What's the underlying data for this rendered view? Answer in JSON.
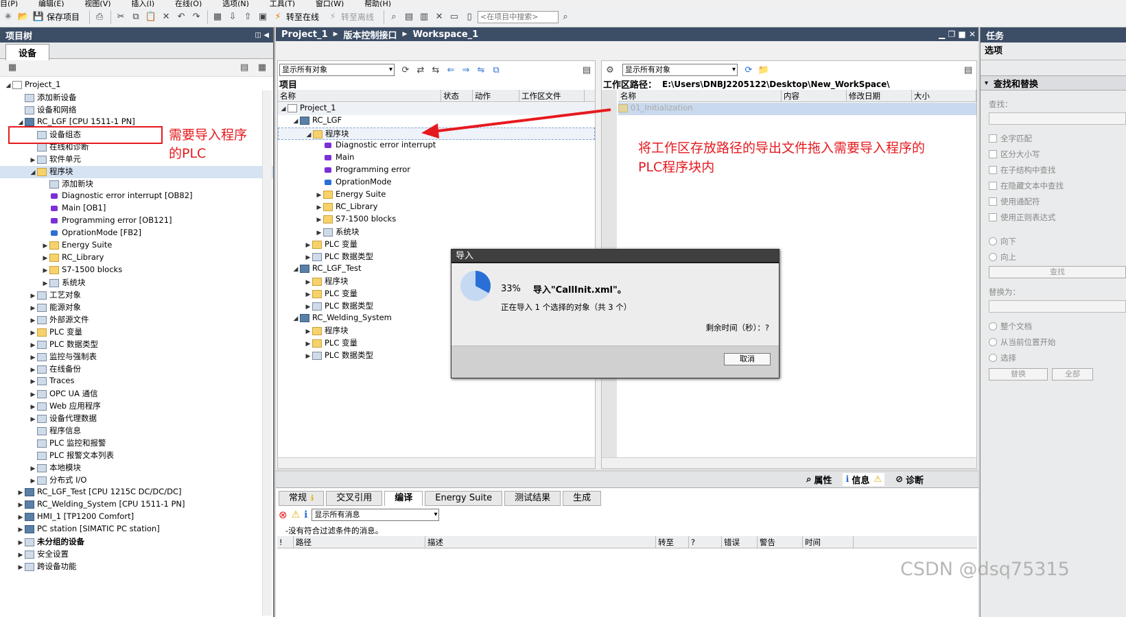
{
  "menu": [
    "目(P)",
    "编辑(E)",
    "视图(V)",
    "插入(I)",
    "在线(O)",
    "选项(N)",
    "工具(T)",
    "窗口(W)",
    "帮助(H)"
  ],
  "toolbar": {
    "save_label": "保存项目",
    "go_online": "转至在线",
    "go_offline": "转至离线",
    "search_placeholder": "<在项目中搜索>"
  },
  "project_tree": {
    "title": "项目树",
    "tab": "设备",
    "rows": [
      {
        "label": "Project_1"
      },
      {
        "label": "添加新设备"
      },
      {
        "label": "设备和网络"
      },
      {
        "label": "RC_LGF [CPU 1511-1 PN]"
      },
      {
        "label": "设备组态"
      },
      {
        "label": "在线和诊断"
      },
      {
        "label": "软件单元"
      },
      {
        "label": "程序块"
      },
      {
        "label": "添加新块"
      },
      {
        "label": "Diagnostic error interrupt [OB82]"
      },
      {
        "label": "Main [OB1]"
      },
      {
        "label": "Programming error [OB121]"
      },
      {
        "label": "OprationMode [FB2]"
      },
      {
        "label": "Energy Suite"
      },
      {
        "label": "RC_Library"
      },
      {
        "label": "S7-1500 blocks"
      },
      {
        "label": "系统块"
      },
      {
        "label": "工艺对象"
      },
      {
        "label": "能源对象"
      },
      {
        "label": "外部源文件"
      },
      {
        "label": "PLC 变量"
      },
      {
        "label": "PLC 数据类型"
      },
      {
        "label": "监控与强制表"
      },
      {
        "label": "在线备份"
      },
      {
        "label": "Traces"
      },
      {
        "label": "OPC UA 通信"
      },
      {
        "label": "Web 应用程序"
      },
      {
        "label": "设备代理数据"
      },
      {
        "label": "程序信息"
      },
      {
        "label": "PLC 监控和报警"
      },
      {
        "label": "PLC 报警文本列表"
      },
      {
        "label": "本地模块"
      },
      {
        "label": "分布式 I/O"
      },
      {
        "label": "RC_LGF_Test [CPU 1215C DC/DC/DC]"
      },
      {
        "label": "RC_Welding_System [CPU 1511-1 PN]"
      },
      {
        "label": "HMI_1 [TP1200 Comfort]"
      },
      {
        "label": "PC station [SIMATIC PC station]"
      },
      {
        "label": "未分组的设备"
      },
      {
        "label": "安全设置"
      },
      {
        "label": "跨设备功能"
      }
    ]
  },
  "annotation_left": {
    "line1": "需要导入程序",
    "line2": "的PLC"
  },
  "annotation_right": {
    "line1": "将工作区存放路径的导出文件拖入需要导入程序的",
    "line2": "PLC程序块内"
  },
  "breadcrumb": {
    "p1": "Project_1",
    "p2": "版本控制接口",
    "p3": "Workspace_1"
  },
  "project_panel": {
    "filter": "显示所有对象",
    "title": "项目",
    "columns": [
      "名称",
      "状态",
      "动作",
      "工作区文件"
    ],
    "rows": [
      {
        "label": "Project_1"
      },
      {
        "label": "RC_LGF"
      },
      {
        "label": "程序块"
      },
      {
        "label": "Diagnostic error interrupt"
      },
      {
        "label": "Main"
      },
      {
        "label": "Programming error"
      },
      {
        "label": "OprationMode"
      },
      {
        "label": "Energy Suite"
      },
      {
        "label": "RC_Library"
      },
      {
        "label": "S7-1500 blocks"
      },
      {
        "label": "系统块"
      },
      {
        "label": "PLC 变量"
      },
      {
        "label": "PLC 数据类型"
      },
      {
        "label": "RC_LGF_Test"
      },
      {
        "label": "程序块"
      },
      {
        "label": "PLC 变量"
      },
      {
        "label": "PLC 数据类型"
      },
      {
        "label": "RC_Welding_System"
      },
      {
        "label": "程序块"
      },
      {
        "label": "PLC 变量"
      },
      {
        "label": "PLC 数据类型"
      }
    ]
  },
  "workspace_panel": {
    "filter": "显示所有对象",
    "path_label": "工作区路径：",
    "path": "E:\\Users\\DNBJ2205122\\Desktop\\New_WorkSpace\\",
    "columns": [
      "名称",
      "内容",
      "修改日期",
      "大小"
    ],
    "rows": [
      {
        "label": "01_Initialization"
      }
    ]
  },
  "dialog": {
    "title": "导入",
    "percent": "33%",
    "progress_fraction": 0.33,
    "message": "导入\"CallInit.xml\"。",
    "status": "正在导入 1 个选择的对象（共 3 个）",
    "remaining": "剩余时间（秒）：?",
    "cancel": "取消"
  },
  "bottom": {
    "inspector_tabs": [
      "属性",
      "信息",
      "诊断"
    ],
    "tabs": [
      "常规",
      "交叉引用",
      "编译",
      "Energy Suite",
      "测试结果",
      "生成"
    ],
    "filter": "显示所有消息",
    "no_messages": "-没有符合过滤条件的消息。",
    "columns": [
      "!",
      "路径",
      "描述",
      "转至",
      "?",
      "错误",
      "警告",
      "时间"
    ]
  },
  "tasks": {
    "title": "任务",
    "subtitle": "选项",
    "section": "查找和替换",
    "find_label": "查找：",
    "checkboxes": [
      "全字匹配",
      "区分大小写",
      "在子结构中查找",
      "在隐藏文本中查找",
      "使用通配符",
      "使用正则表达式"
    ],
    "direction": [
      "向下",
      "向上"
    ],
    "find_button": "查找",
    "replace_label": "替换为：",
    "scope": [
      "整个文档",
      "从当前位置开始",
      "选择"
    ],
    "replace_button": "替换",
    "replace_all_button": "全部"
  },
  "watermark": "CSDN @dsq75315",
  "colors": {
    "header": "#3c4d66",
    "annotation_red": "#e6191e",
    "selection": "#d5e3f3"
  }
}
